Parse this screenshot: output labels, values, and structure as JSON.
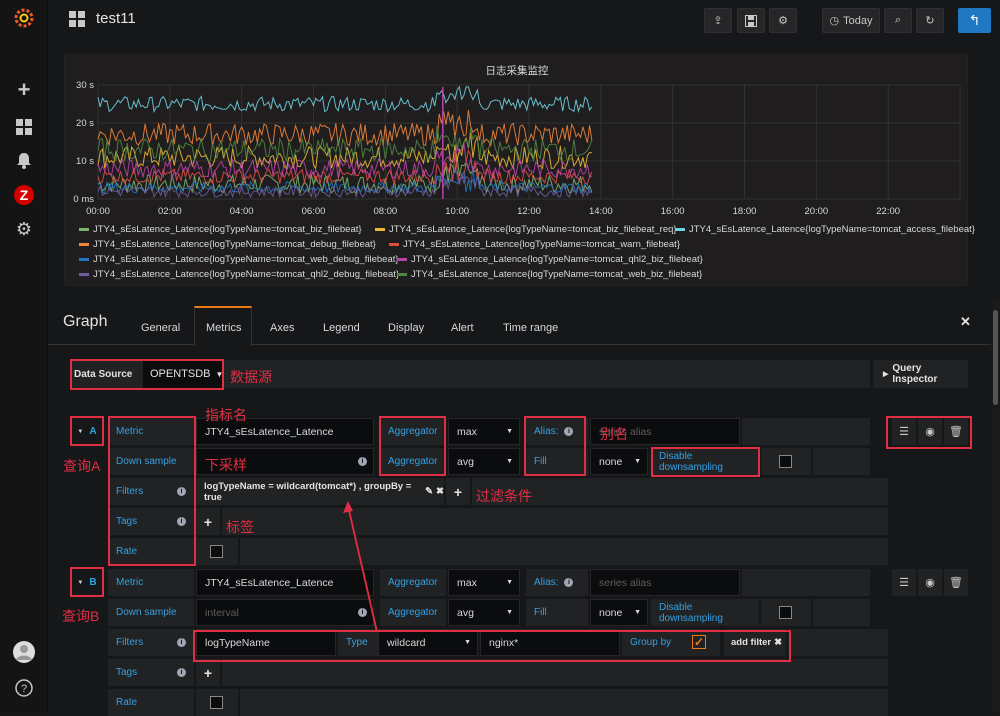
{
  "sidebar": {
    "items": [
      "plus-icon",
      "dashboards-icon",
      "bell-icon",
      "zabbix-icon",
      "gear-icon"
    ]
  },
  "topbar": {
    "title": "test11",
    "time_label": "Today"
  },
  "panel": {
    "title": "日志采集监控"
  },
  "chart_data": {
    "type": "line",
    "title": "日志采集监控",
    "xlabel": "",
    "ylabel": "",
    "x_ticks": [
      "00:00",
      "02:00",
      "04:00",
      "06:00",
      "08:00",
      "10:00",
      "12:00",
      "14:00",
      "16:00",
      "18:00",
      "20:00",
      "22:00"
    ],
    "y_ticks": [
      "0 ms",
      "10 s",
      "20 s",
      "30 s"
    ],
    "ylim": [
      0,
      30
    ],
    "grid": true,
    "legend_position": "bottom",
    "series": [
      {
        "name": "JTY4_sEsLatence_Latence{logTypeName=tomcat_biz_filebeat}",
        "color": "#7eb26d"
      },
      {
        "name": "JTY4_sEsLatence_Latence{logTypeName=tomcat_biz_filebeat_req}",
        "color": "#eab839"
      },
      {
        "name": "JTY4_sEsLatence_Latence{logTypeName=tomcat_access_filebeat}",
        "color": "#6ed0e0"
      },
      {
        "name": "JTY4_sEsLatence_Latence{logTypeName=tomcat_debug_filebeat}",
        "color": "#ef843c"
      },
      {
        "name": "JTY4_sEsLatence_Latence{logTypeName=tomcat_warn_filebeat}",
        "color": "#e24d42"
      },
      {
        "name": "JTY4_sEsLatence_Latence{logTypeName=tomcat_web_debug_filebeat}",
        "color": "#1f78c1"
      },
      {
        "name": "JTY4_sEsLatence_Latence{logTypeName=tomcat_qhl2_biz_filebeat}",
        "color": "#ba43a9"
      },
      {
        "name": "JTY4_sEsLatence_Latence{logTypeName=tomcat_qhl2_debug_filebeat}",
        "color": "#705da0"
      },
      {
        "name": "JTY4_sEsLatence_Latence{logTypeName=tomcat_web_biz_filebeat}",
        "color": "#508642"
      }
    ]
  },
  "editor": {
    "title": "Graph",
    "tabs": [
      "General",
      "Metrics",
      "Axes",
      "Legend",
      "Display",
      "Alert",
      "Time range"
    ],
    "active_tab": "Metrics"
  },
  "datasource": {
    "label": "Data Source",
    "value": "OPENTSDB",
    "query_inspector": "Query Inspector"
  },
  "queryA": {
    "ref": "A",
    "metric_label": "Metric",
    "metric_value": "JTY4_sEsLatence_Latence",
    "aggregator_label": "Aggregator",
    "aggregator_value": "max",
    "alias_label": "Alias:",
    "alias_placeholder": "series alias",
    "downsample_label": "Down sample",
    "downsample_aggregator_label": "Aggregator",
    "downsample_aggregator_value": "avg",
    "fill_label": "Fill",
    "fill_value": "none",
    "disable_downsampling": "Disable downsampling",
    "filters_label": "Filters",
    "filter_value": "logTypeName = wildcard(tomcat*) , groupBy = true",
    "tags_label": "Tags",
    "rate_label": "Rate"
  },
  "queryB": {
    "ref": "B",
    "metric_label": "Metric",
    "metric_value": "JTY4_sEsLatence_Latence",
    "aggregator_label": "Aggregator",
    "aggregator_value": "max",
    "alias_label": "Alias:",
    "alias_placeholder": "series alias",
    "downsample_label": "Down sample",
    "downsample_placeholder": "interval",
    "downsample_aggregator_label": "Aggregator",
    "downsample_aggregator_value": "avg",
    "fill_label": "Fill",
    "fill_value": "none",
    "disable_downsampling": "Disable downsampling",
    "filters_label": "Filters",
    "filter_key": "logTypeName",
    "type_label": "Type",
    "type_value": "wildcard",
    "filter_value": "nginx*",
    "groupby_label": "Group by",
    "add_filter": "add filter",
    "tags_label": "Tags",
    "rate_label": "Rate"
  },
  "annotations": {
    "datasource": "数据源",
    "metric_name": "指标名",
    "alias": "别名",
    "downsample": "下采样",
    "filter_cond": "过滤条件",
    "tags": "标签",
    "queryA": "查询A",
    "queryB": "查询B"
  },
  "colors": {
    "accent": "#33a2e5",
    "annotation": "#e02f44",
    "primary_button": "#1f78c1",
    "checkbox": "#eb7b18"
  }
}
